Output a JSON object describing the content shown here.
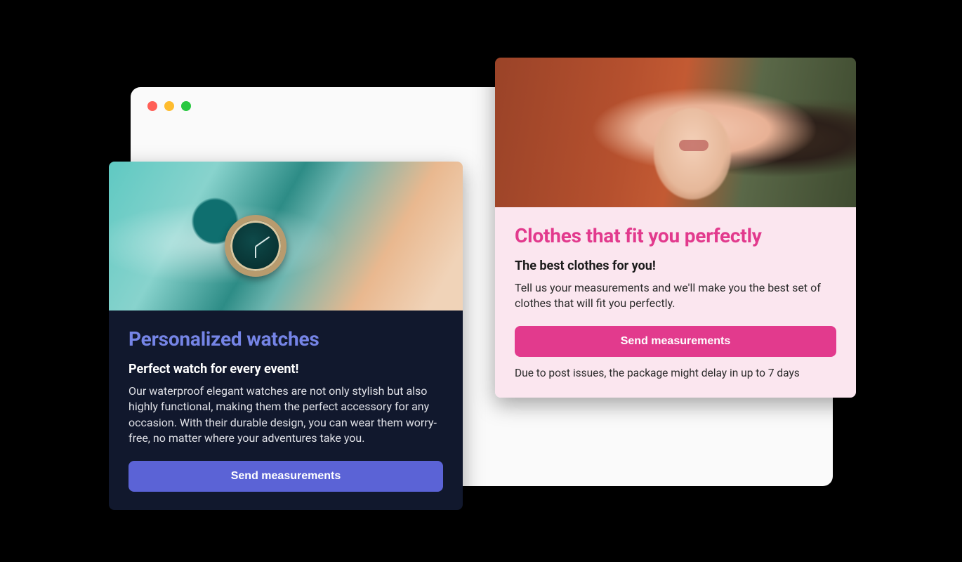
{
  "window": {
    "trafficLights": [
      "red",
      "yellow",
      "green"
    ]
  },
  "cards": {
    "watch": {
      "title": "Personalized watches",
      "subtitle": "Perfect watch for every event!",
      "description": "Our waterproof elegant watches are not only stylish but also highly functional, making them the perfect accessory for any occasion. With their durable design, you can wear them worry-free, no matter where your adventures take you.",
      "button": "Send measurements"
    },
    "clothes": {
      "title": "Clothes that fit you perfectly",
      "subtitle": "The best clothes for you!",
      "description": "Tell us your measurements and we'll make you the best set of clothes that will fit you perfectly.",
      "button": "Send measurements",
      "footnote": "Due to post issues, the package might delay in up to 7 days"
    }
  },
  "colors": {
    "accentIndigo": "#5b63d6",
    "accentPink": "#e23a8d",
    "cardDarkBg": "#11182d",
    "cardPinkBg": "#fbe6ef"
  }
}
